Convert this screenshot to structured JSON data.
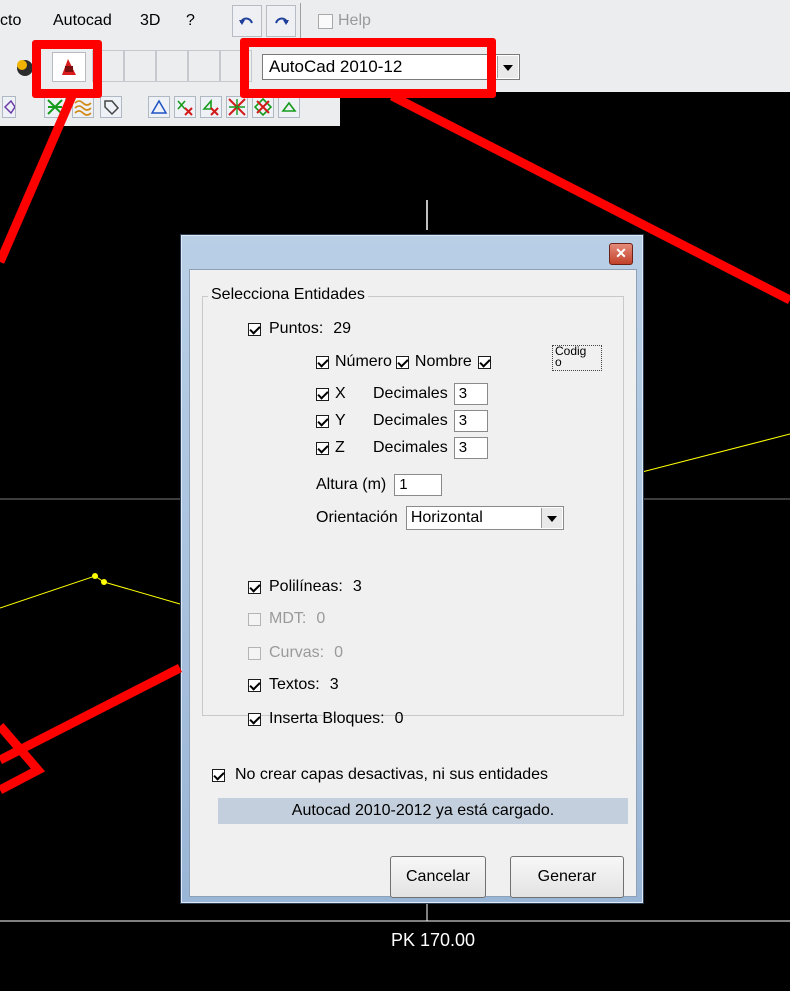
{
  "menu": {
    "items": [
      "cto",
      "Autocad",
      "3D",
      "?"
    ],
    "help_label": "Help"
  },
  "toolbar": {
    "version_value": "AutoCad 2010-12"
  },
  "canvas": {
    "pk_label": "PK 170.00",
    "line_color": "#ffff00",
    "annotation_color": "#ff0000"
  },
  "dialog": {
    "close_glyph": "✕",
    "group_title": "Selecciona Entidades",
    "points": {
      "label": "Puntos:",
      "count": "29",
      "checked": true
    },
    "fields": {
      "numero": "Número",
      "nombre": "Nombre",
      "codigo": "Codig\no"
    },
    "coords": [
      {
        "axis": "X",
        "decimals_label": "Decimales",
        "value": "3"
      },
      {
        "axis": "Y",
        "decimals_label": "Decimales",
        "value": "3"
      },
      {
        "axis": "Z",
        "decimals_label": "Decimales",
        "value": "3"
      }
    ],
    "height": {
      "label": "Altura (m)",
      "value": "1"
    },
    "orientation": {
      "label": "Orientación",
      "value": "Horizontal"
    },
    "entities": [
      {
        "label": "Polilíneas:",
        "count": "3",
        "checked": true,
        "enabled": true
      },
      {
        "label": "MDT:",
        "count": "0",
        "checked": false,
        "enabled": false
      },
      {
        "label": "Curvas:",
        "count": "0",
        "checked": false,
        "enabled": false
      },
      {
        "label": "Textos:",
        "count": "3",
        "checked": true,
        "enabled": true
      },
      {
        "label": "Inserta Bloques:",
        "count": "0",
        "checked": true,
        "enabled": true
      }
    ],
    "no_layers_option": "No crear capas desactivas, ni sus entidades",
    "status": "Autocad 2010-2012 ya está cargado.",
    "cancel_label": "Cancelar",
    "generate_label": "Generar"
  }
}
